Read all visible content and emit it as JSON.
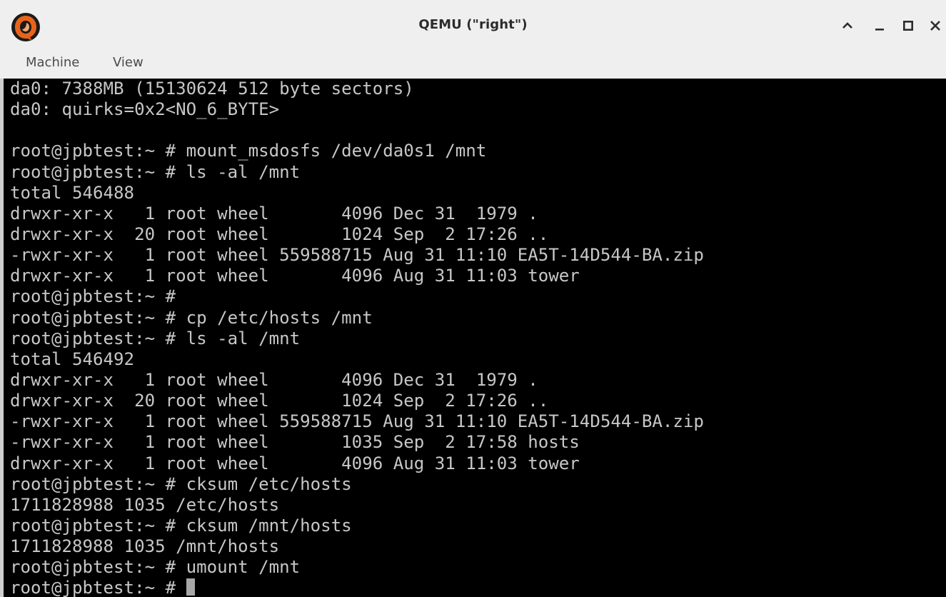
{
  "window": {
    "title": "QEMU (\"right\")",
    "app_icon": "qemu-logo-icon",
    "controls": [
      {
        "name": "collapse",
        "icon": "chevron-up-icon"
      },
      {
        "name": "minimize",
        "icon": "minimize-icon"
      },
      {
        "name": "maximize",
        "icon": "maximize-icon"
      },
      {
        "name": "close",
        "icon": "close-icon"
      }
    ]
  },
  "menubar": {
    "items": [
      "Machine",
      "View"
    ]
  },
  "console": {
    "lines": [
      "da0: 7388MB (15130624 512 byte sectors)",
      "da0: quirks=0x2<NO_6_BYTE>",
      "",
      "root@jpbtest:~ # mount_msdosfs /dev/da0s1 /mnt",
      "root@jpbtest:~ # ls -al /mnt",
      "total 546488",
      "drwxr-xr-x   1 root wheel       4096 Dec 31  1979 .",
      "drwxr-xr-x  20 root wheel       1024 Sep  2 17:26 ..",
      "-rwxr-xr-x   1 root wheel 559588715 Aug 31 11:10 EA5T-14D544-BA.zip",
      "drwxr-xr-x   1 root wheel       4096 Aug 31 11:03 tower",
      "root@jpbtest:~ #",
      "root@jpbtest:~ # cp /etc/hosts /mnt",
      "root@jpbtest:~ # ls -al /mnt",
      "total 546492",
      "drwxr-xr-x   1 root wheel       4096 Dec 31  1979 .",
      "drwxr-xr-x  20 root wheel       1024 Sep  2 17:26 ..",
      "-rwxr-xr-x   1 root wheel 559588715 Aug 31 11:10 EA5T-14D544-BA.zip",
      "-rwxr-xr-x   1 root wheel       1035 Sep  2 17:58 hosts",
      "drwxr-xr-x   1 root wheel       4096 Aug 31 11:03 tower",
      "root@jpbtest:~ # cksum /etc/hosts",
      "1711828988 1035 /etc/hosts",
      "root@jpbtest:~ # cksum /mnt/hosts",
      "1711828988 1035 /mnt/hosts",
      "root@jpbtest:~ # umount /mnt"
    ],
    "prompt": "root@jpbtest:~ # "
  },
  "colors": {
    "terminal_bg": "#000000",
    "terminal_fg": "#c7c7c7",
    "titlebar_bg": "#efefef",
    "qemu_orange": "#e8641b"
  }
}
